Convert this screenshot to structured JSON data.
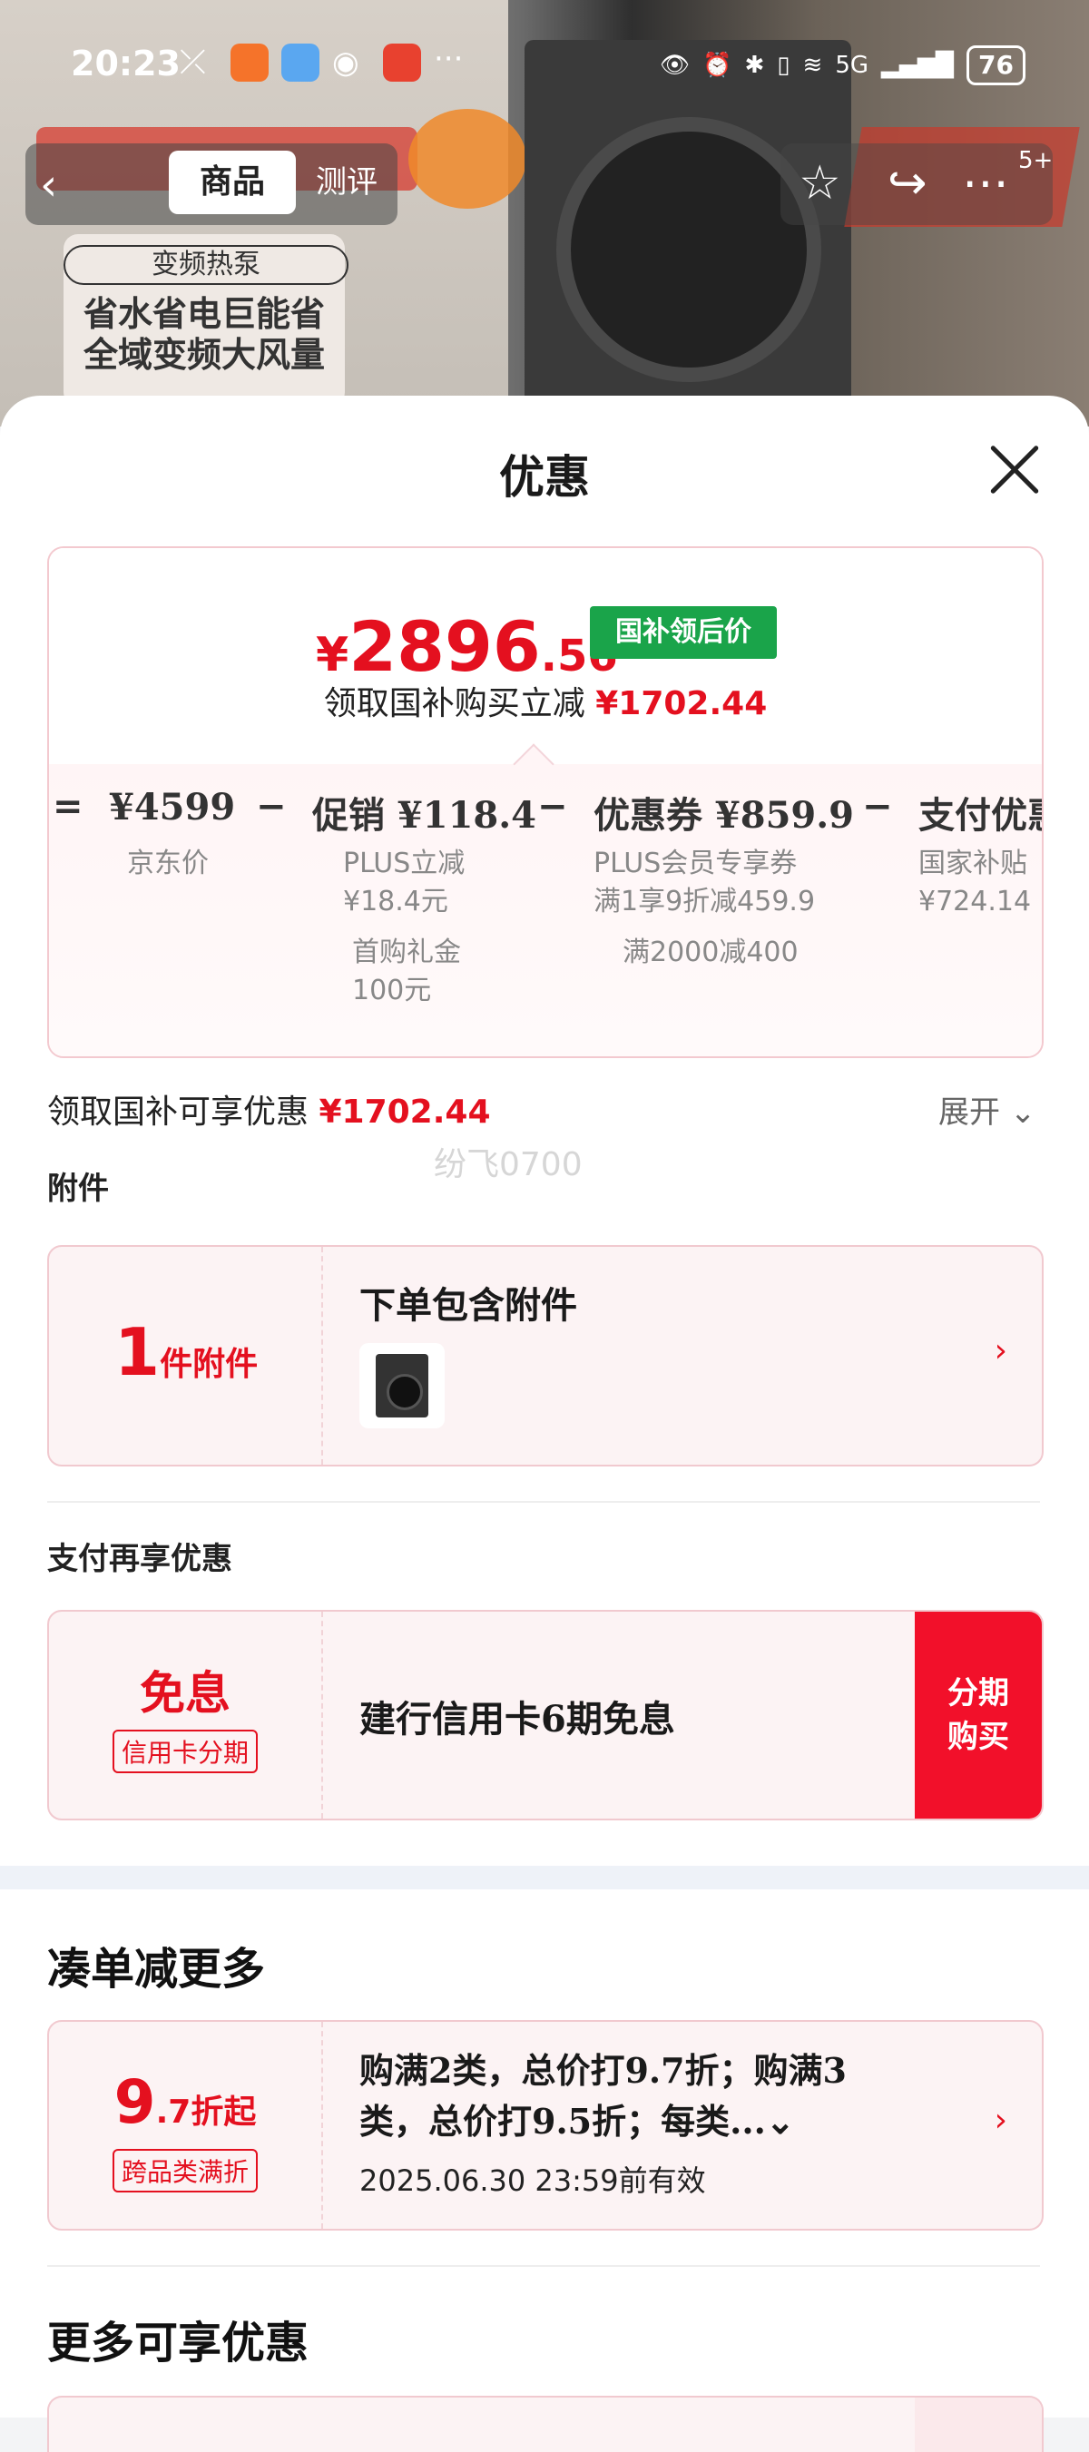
{
  "status_bar": {
    "time": "20:23",
    "battery": "76",
    "network": "5G"
  },
  "background": {
    "poster_chip": "变频热泵",
    "poster_line1": "省水省电巨能省",
    "poster_line2": "全域变频大风量"
  },
  "top_nav": {
    "tab_product": "商品",
    "tab_review": "测评",
    "cart_badge": "5+"
  },
  "sheet": {
    "title": "优惠"
  },
  "price_card": {
    "symbol": "¥",
    "final_int": "2896",
    "final_dec": ".56",
    "tag": "国补领后价",
    "reduce_text": "领取国补购买立减",
    "reduce_amount": "¥1702.44",
    "breakdown": {
      "eq": "=",
      "jd_price": "¥4599",
      "jd_label": "京东价",
      "minus1": "−",
      "promo": "促销 ¥118.4",
      "promo_sub1": "PLUS立减",
      "promo_sub2": "¥18.4元",
      "promo_sub3": "首购礼金",
      "promo_sub4": "100元",
      "minus2": "−",
      "coupon": "优惠券 ¥859.9",
      "coupon_sub1": "PLUS会员专享券",
      "coupon_sub2": "满1享9折减459.9",
      "coupon_sub3": "满2000减400",
      "minus3": "−",
      "pay": "支付优惠",
      "pay_sub1": "国家补贴",
      "pay_sub2": "¥724.14"
    }
  },
  "discount_summary": {
    "label": "领取国补可享优惠",
    "amount": "¥1702.44",
    "expand": "展开"
  },
  "watermark": "纷飞0700",
  "accessories": {
    "label": "附件",
    "count": "1",
    "count_unit": "件附件",
    "title": "下单包含附件"
  },
  "payment": {
    "label": "支付再享优惠",
    "badge_big": "免息",
    "badge_small": "信用卡分期",
    "text": "建行信用卡6期免息",
    "button_line1": "分期",
    "button_line2": "购买"
  },
  "bundle": {
    "title": "凑单减更多",
    "big": "9",
    "big_suffix": ".7折起",
    "badge_small": "跨品类满折",
    "line1": "购满2类，总价打9.7折；购满3",
    "line2": "类，总价打9.5折；每类...",
    "validity": "2025.06.30 23:59前有效"
  },
  "more": {
    "title": "更多可享优惠"
  }
}
